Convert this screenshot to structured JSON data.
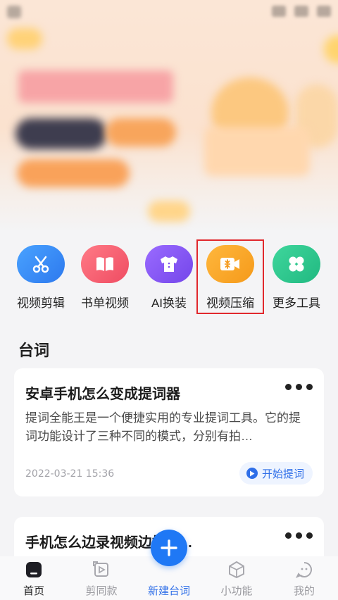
{
  "banner": {
    "description_hidden": true
  },
  "tools": [
    {
      "label": "视频剪辑",
      "icon": "scissors-icon",
      "color": "#3f8ef4"
    },
    {
      "label": "书单视频",
      "icon": "book-icon",
      "color": "#f35d6e"
    },
    {
      "label": "AI换装",
      "icon": "shirt-icon",
      "color": "#8458f0"
    },
    {
      "label": "视频压缩",
      "icon": "video-compress-icon",
      "color": "#f7a225"
    },
    {
      "label": "更多工具",
      "icon": "clover-icon",
      "color": "#2fc68d"
    }
  ],
  "section": {
    "title": "台词"
  },
  "cards": [
    {
      "title": "安卓手机怎么变成提词器",
      "desc": "提词全能王是一个便捷实用的专业提词工具。它的提词功能设计了三种不同的模式，分别有拍…",
      "date": "2022-03-21 15:36",
      "action": "开始提词"
    },
    {
      "title": "手机怎么边录视频边提词..."
    }
  ],
  "nav": {
    "items": [
      {
        "label": "首页",
        "icon": "home-icon"
      },
      {
        "label": "剪同款",
        "icon": "template-icon"
      },
      {
        "label": "新建台词",
        "icon": "plus-icon"
      },
      {
        "label": "小功能",
        "icon": "cube-icon"
      },
      {
        "label": "我的",
        "icon": "profile-icon"
      }
    ]
  },
  "colors": {
    "accent": "#1f78f5",
    "highlight_box": "#e1282d"
  }
}
